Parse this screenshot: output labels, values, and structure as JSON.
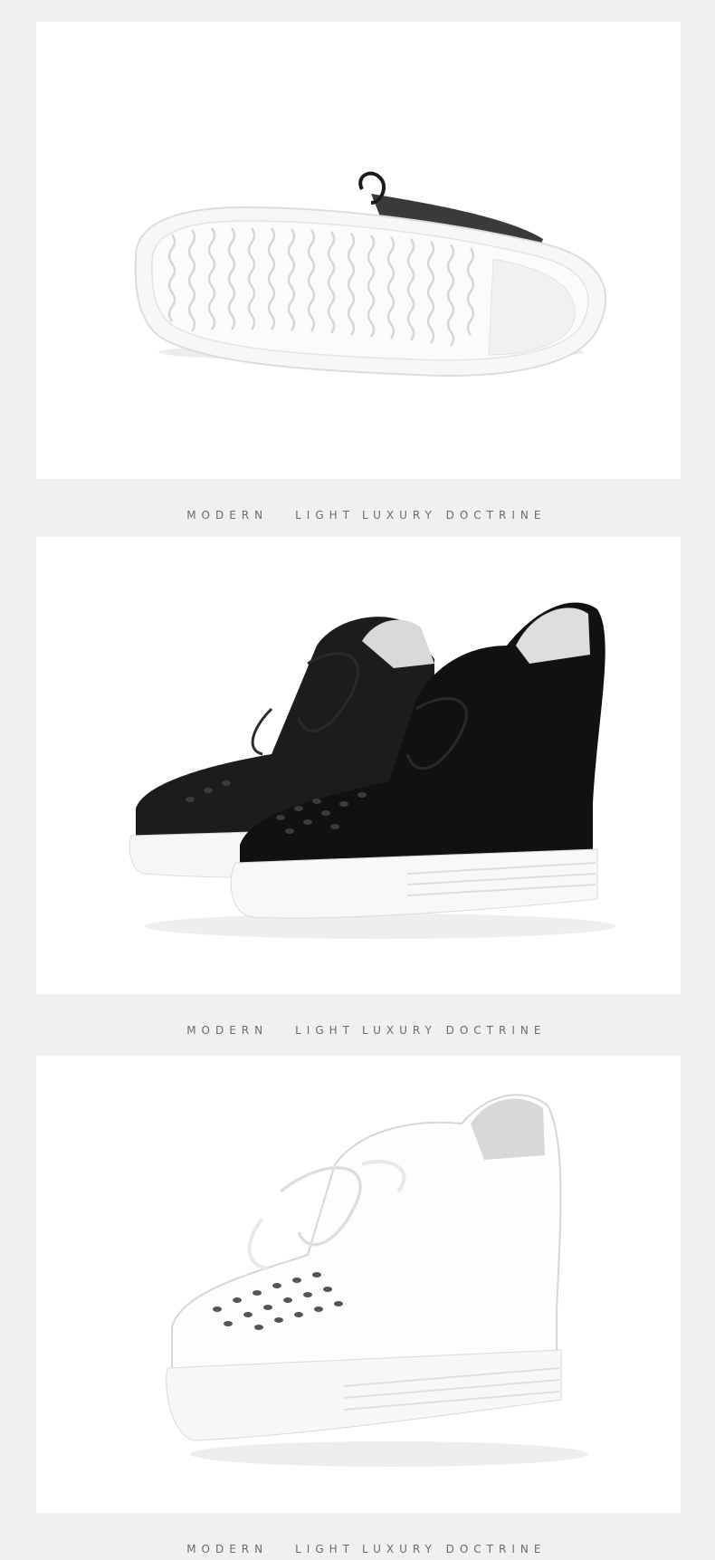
{
  "sections": [
    {
      "image": "white-sole-bottom-view",
      "caption": [
        "MODERN",
        "LIGHT",
        "LUXURY DOCTRINE"
      ]
    },
    {
      "image": "black-perforated-wedge-sneakers-pair",
      "caption": [
        "MODERN",
        "LIGHT",
        "LUXURY DOCTRINE"
      ]
    },
    {
      "image": "white-perforated-wedge-sneaker",
      "caption": [
        "MODERN",
        "LIGHT",
        "LUXURY DOCTRINE"
      ]
    }
  ],
  "colors": {
    "page_background": "#f0f0f0",
    "panel_background": "#ffffff",
    "caption_text": "#6a6a6a"
  }
}
